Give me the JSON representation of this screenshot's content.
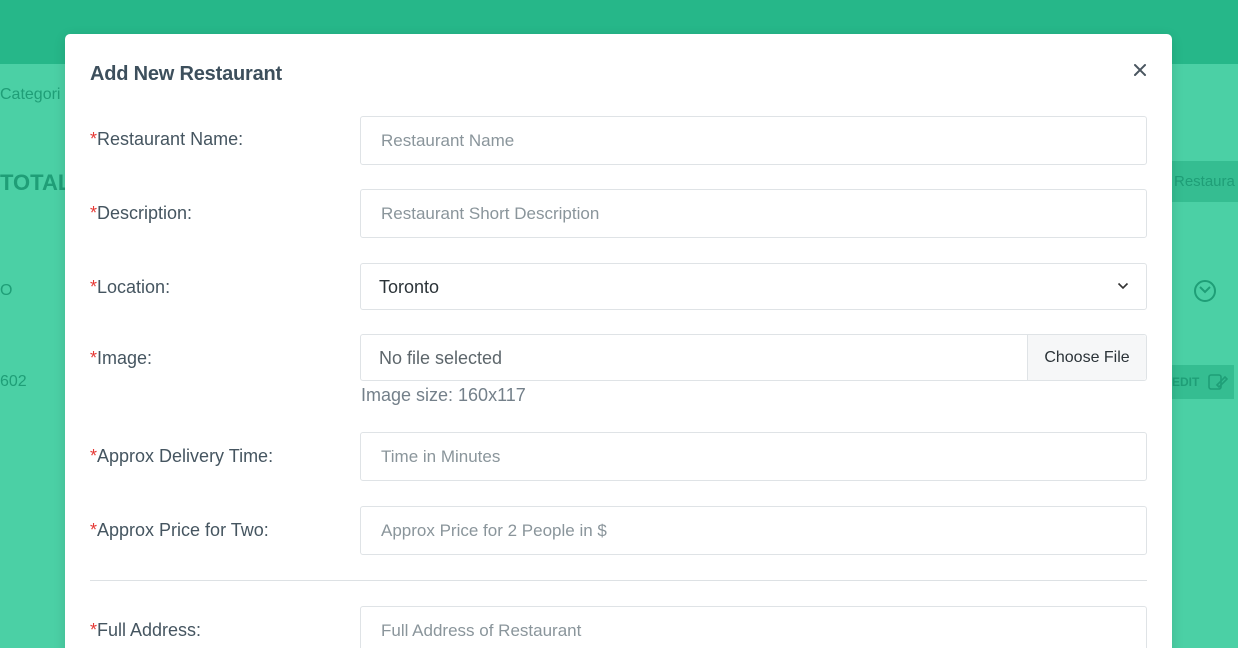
{
  "background": {
    "categories_text": "Categori",
    "total_text": "TOTAL",
    "add_button_text": "Restaura",
    "row1_text": "O",
    "row2_text": "602",
    "edit_button_text": "EDIT"
  },
  "modal": {
    "title": "Add New Restaurant",
    "close_label": "×",
    "required_marker": "*",
    "fields": {
      "name": {
        "label": "Restaurant Name:",
        "placeholder": "Restaurant Name"
      },
      "description": {
        "label": "Description:",
        "placeholder": "Restaurant Short Description"
      },
      "location": {
        "label": "Location:",
        "value": "Toronto"
      },
      "image": {
        "label": "Image:",
        "file_status": "No file selected",
        "button_label": "Choose File",
        "hint": "Image size: 160x117"
      },
      "delivery_time": {
        "label": "Approx Delivery Time:",
        "placeholder": "Time in Minutes"
      },
      "price_for_two": {
        "label": "Approx Price for Two:",
        "placeholder": "Approx Price for 2 People in $"
      },
      "address": {
        "label": "Full Address:",
        "placeholder": "Full Address of Restaurant"
      }
    }
  },
  "icons": {
    "close": "close-icon",
    "select_arrow": "chevron-down-icon",
    "expand": "chevron-circle-down-icon",
    "edit": "edit-icon"
  },
  "colors": {
    "header": "#26b789",
    "backdrop": "#4bd0a5",
    "required": "#e53935",
    "title": "#3d4f5c"
  }
}
